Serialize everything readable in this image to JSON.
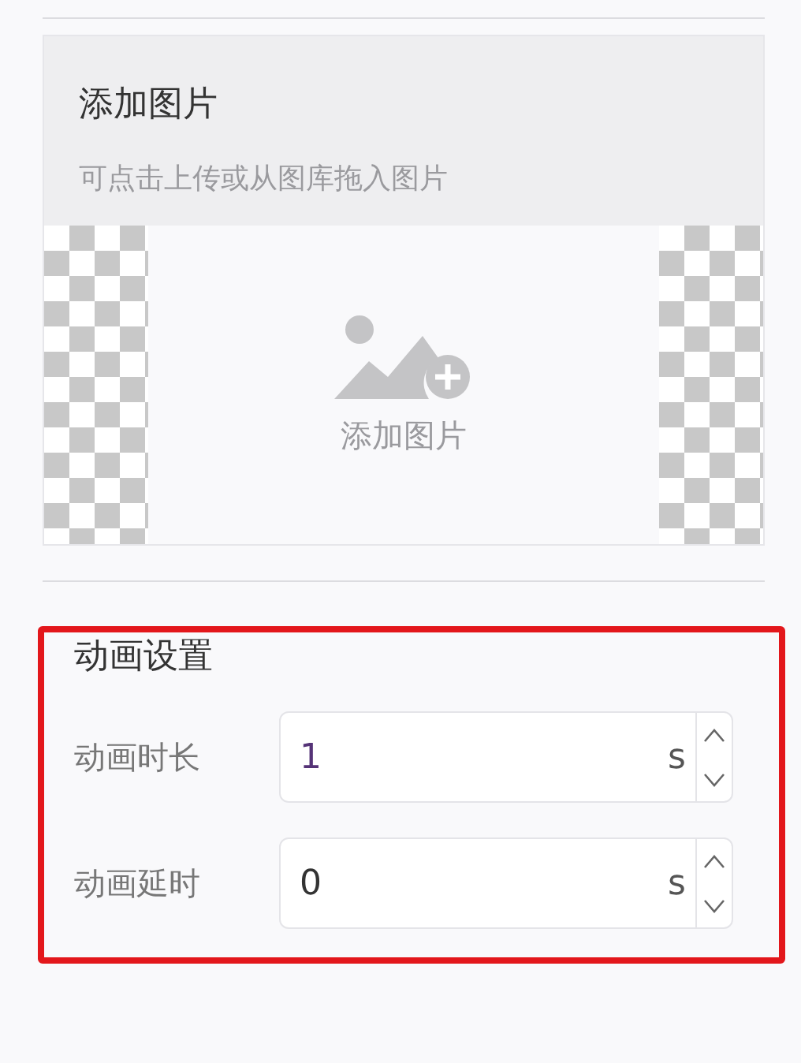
{
  "image_card": {
    "title": "添加图片",
    "hint": "可点击上传或从图库拖入图片",
    "upload_label": "添加图片"
  },
  "animation": {
    "title": "动画设置",
    "fields": [
      {
        "label": "动画时长",
        "value": "1",
        "unit": "s"
      },
      {
        "label": "动画延时",
        "value": "0",
        "unit": "s"
      }
    ]
  }
}
